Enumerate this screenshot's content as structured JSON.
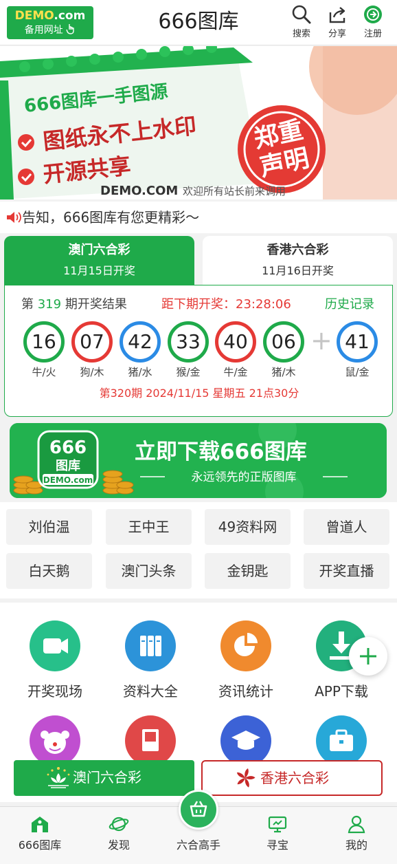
{
  "header": {
    "logo_top": "DEMO",
    "logo_top_suffix": ".com",
    "logo_bottom": "备用网址",
    "title": "666图库",
    "search_label": "搜索",
    "share_label": "分享",
    "register_label": "注册"
  },
  "banner": {
    "line1": "666图库一手图源",
    "line2": "图纸永不上水印",
    "line3": "开源共享",
    "stamp1": "郑重",
    "stamp2": "声明",
    "footer_brand": "DEMO.COM",
    "footer_text": "欢迎所有站长前来调用"
  },
  "notice": {
    "text": "告知，666图库有您更精彩～"
  },
  "lottery": {
    "tabs": [
      {
        "name": "澳门六合彩",
        "date": "11月15日开奖"
      },
      {
        "name": "香港六合彩",
        "date": "11月16日开奖"
      }
    ],
    "issue_prefix": "第",
    "issue_number": "319",
    "issue_suffix": "期开奖结果",
    "countdown": "距下期开奖：23:28:06",
    "history": "历史记录",
    "balls": [
      {
        "num": "16",
        "zodiac": "牛/火",
        "color": "green"
      },
      {
        "num": "07",
        "zodiac": "狗/木",
        "color": "red"
      },
      {
        "num": "42",
        "zodiac": "猪/水",
        "color": "blue"
      },
      {
        "num": "33",
        "zodiac": "猴/金",
        "color": "green"
      },
      {
        "num": "40",
        "zodiac": "牛/金",
        "color": "red"
      },
      {
        "num": "06",
        "zodiac": "猪/木",
        "color": "green"
      },
      {
        "num": "41",
        "zodiac": "鼠/金",
        "color": "blue"
      }
    ],
    "plus": "+",
    "next_draw": "第320期 2024/11/15 星期五 21点30分"
  },
  "download_banner": {
    "logo_num": "666",
    "logo_name": "图库",
    "logo_domain": "DEMO.com",
    "headline": "立即下载666图库",
    "sub": "永远领先的正版图库"
  },
  "links": [
    "刘伯温",
    "王中王",
    "49资料网",
    "曾道人",
    "白天鹅",
    "澳门头条",
    "金钥匙",
    "开奖直播"
  ],
  "features": [
    {
      "label": "开奖现场",
      "icon": "video-icon",
      "color": "#27c08a"
    },
    {
      "label": "资料大全",
      "icon": "books-icon",
      "color": "#2c93d9"
    },
    {
      "label": "资讯统计",
      "icon": "pie-chart-icon",
      "color": "#f08a2e"
    },
    {
      "label": "APP下载",
      "icon": "download-icon",
      "color": "#22b07d"
    },
    {
      "label": "",
      "icon": "clown-icon",
      "color": "#c04fd0"
    },
    {
      "label": "",
      "icon": "book-icon",
      "color": "#e04848"
    },
    {
      "label": "",
      "icon": "graduation-cap-icon",
      "color": "#3c62d6"
    },
    {
      "label": "",
      "icon": "briefcase-icon",
      "color": "#27a8d8"
    }
  ],
  "lottery_buttons": {
    "macau": "澳门六合彩",
    "hongkong": "香港六合彩"
  },
  "bottom_nav": [
    {
      "label": "666图库",
      "icon": "home-icon"
    },
    {
      "label": "发现",
      "icon": "planet-icon"
    },
    {
      "label": "六合高手",
      "icon": "basket-icon"
    },
    {
      "label": "寻宝",
      "icon": "monitor-icon"
    },
    {
      "label": "我的",
      "icon": "user-icon"
    }
  ],
  "colors": {
    "brand_green": "#1faa4a",
    "red": "#e53935",
    "blue": "#2b8be5",
    "hk_red": "#c62828"
  }
}
